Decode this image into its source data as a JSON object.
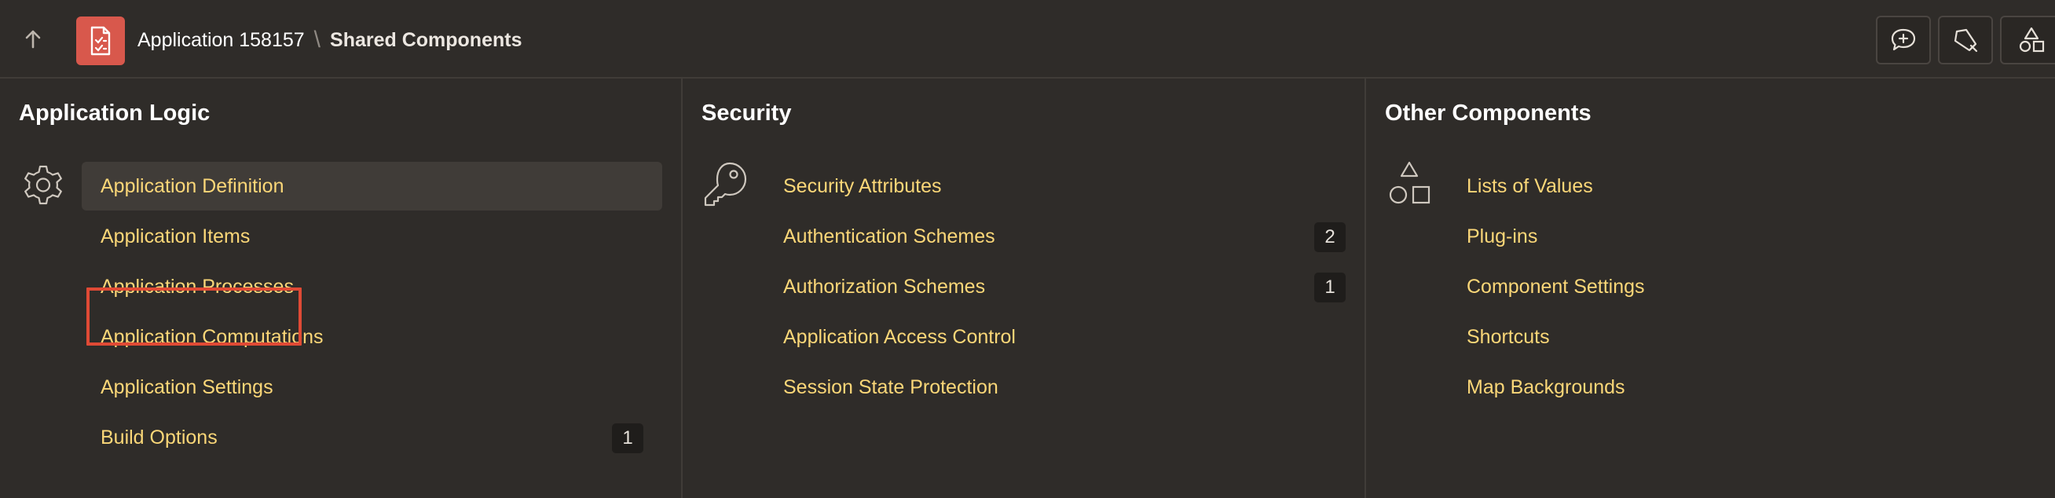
{
  "header": {
    "up_icon": "arrow-up-icon",
    "app_icon": "app-icon",
    "breadcrumb": {
      "app": "Application 158157",
      "separator": "\\",
      "current": "Shared Components"
    },
    "tools": [
      "feedback-icon",
      "developer-icon",
      "shapes-icon"
    ]
  },
  "panels": [
    {
      "title": "Application Logic",
      "icon": "gear-icon",
      "items": [
        {
          "label": "Application Definition",
          "badge": ""
        },
        {
          "label": "Application Items",
          "badge": ""
        },
        {
          "label": "Application Processes",
          "badge": ""
        },
        {
          "label": "Application Computations",
          "badge": ""
        },
        {
          "label": "Application Settings",
          "badge": ""
        },
        {
          "label": "Build Options",
          "badge": "1"
        }
      ]
    },
    {
      "title": "Security",
      "icon": "key-icon",
      "items": [
        {
          "label": "Security Attributes",
          "badge": ""
        },
        {
          "label": "Authentication Schemes",
          "badge": "2"
        },
        {
          "label": "Authorization Schemes",
          "badge": "1"
        },
        {
          "label": "Application Access Control",
          "badge": ""
        },
        {
          "label": "Session State Protection",
          "badge": ""
        }
      ]
    },
    {
      "title": "Other Components",
      "icon": "shapes-icon",
      "items": [
        {
          "label": "Lists of Values",
          "badge": ""
        },
        {
          "label": "Plug-ins",
          "badge": ""
        },
        {
          "label": "Component Settings",
          "badge": ""
        },
        {
          "label": "Shortcuts",
          "badge": ""
        },
        {
          "label": "Map Backgrounds",
          "badge": ""
        }
      ]
    }
  ],
  "colors": {
    "background": "#2f2c29",
    "link": "#fbd778",
    "app_icon_bg": "#d8584c",
    "highlight": "#e04a35"
  }
}
